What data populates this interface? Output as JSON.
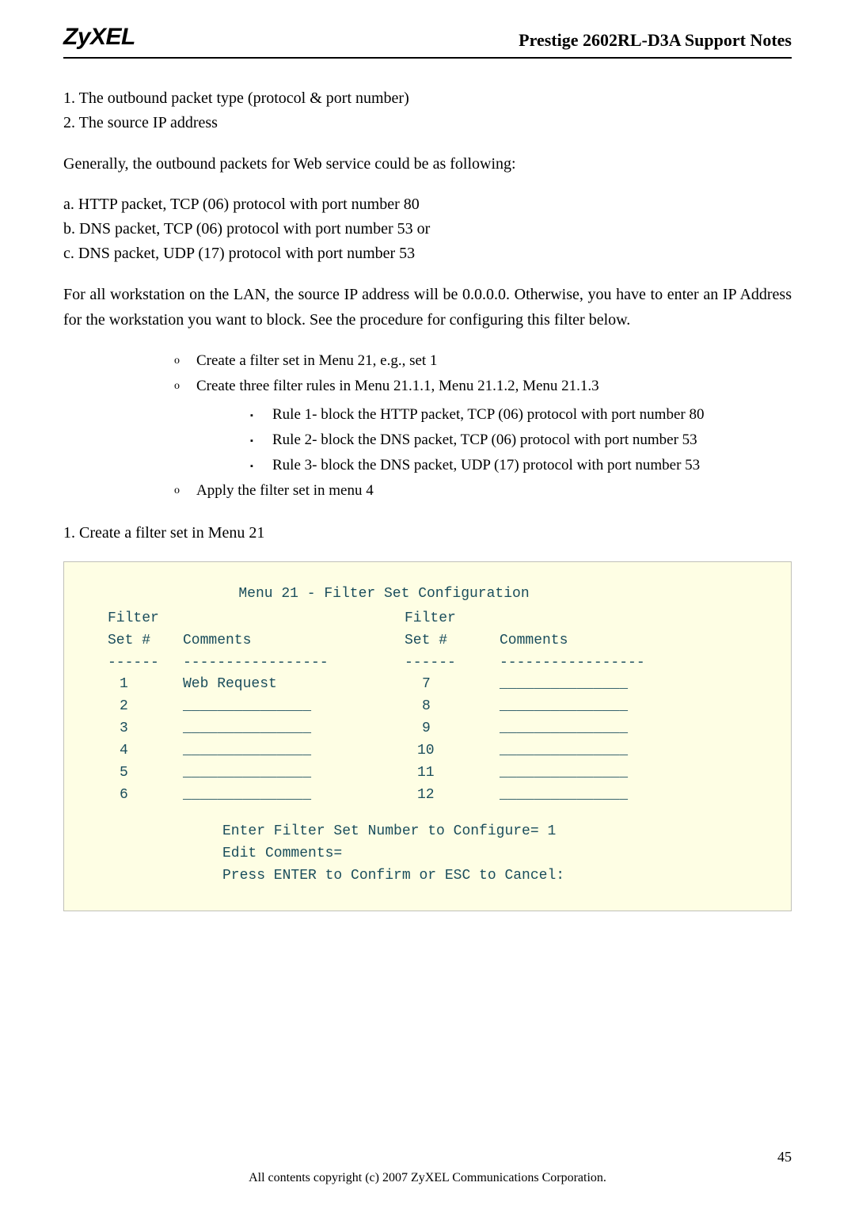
{
  "header": {
    "logo": "ZyXEL",
    "title": "Prestige 2602RL-D3A Support Notes"
  },
  "intro": {
    "line1": "1. The outbound packet type (protocol & port number)",
    "line2": "2. The source IP address"
  },
  "para1": "Generally, the outbound packets for Web service could be as following:",
  "packets": {
    "a": "a. HTTP packet, TCP (06) protocol with port number 80",
    "b": "b. DNS packet, TCP (06) protocol with port number 53 or",
    "c": "c. DNS packet, UDP (17) protocol with port number 53"
  },
  "para2": "For all workstation on the LAN, the source IP address will be 0.0.0.0. Otherwise, you have to enter an IP Address for the workstation you want to block. See the procedure for configuring this filter below.",
  "bullets": {
    "b1": "Create a filter set in Menu 21, e.g., set 1",
    "b2": "Create three filter rules in Menu 21.1.1, Menu 21.1.2, Menu 21.1.3",
    "sub1": "Rule 1- block the HTTP packet, TCP (06) protocol with port number 80",
    "sub2": "Rule 2- block the DNS packet, TCP (06) protocol with port number 53",
    "sub3": "Rule 3- block the DNS packet, UDP (17) protocol with port number 53",
    "b3": "Apply the filter set in menu 4"
  },
  "step1": "1. Create a filter set in Menu 21",
  "terminal": {
    "title": "Menu 21 - Filter Set Configuration",
    "hdr_filter": "Filter",
    "hdr_set": "Set #",
    "hdr_comments": "Comments",
    "dash6": "------",
    "dash17": "-----------------",
    "rows": [
      {
        "n1": "1",
        "c1": "Web Request",
        "n2": "7",
        "c2": "_______________"
      },
      {
        "n1": "2",
        "c1": "_______________",
        "n2": "8",
        "c2": "_______________"
      },
      {
        "n1": "3",
        "c1": "_______________",
        "n2": "9",
        "c2": "_______________"
      },
      {
        "n1": "4",
        "c1": "_______________",
        "n2": "10",
        "c2": "_______________"
      },
      {
        "n1": "5",
        "c1": "_______________",
        "n2": "11",
        "c2": "_______________"
      },
      {
        "n1": "6",
        "c1": "_______________",
        "n2": "12",
        "c2": "_______________"
      }
    ],
    "prompt1": "Enter Filter Set Number to Configure= 1",
    "prompt2": "Edit Comments=",
    "prompt3": "Press ENTER to Confirm or ESC to Cancel:"
  },
  "footer": {
    "page": "45",
    "copyright": "All contents copyright (c) 2007 ZyXEL Communications Corporation."
  }
}
